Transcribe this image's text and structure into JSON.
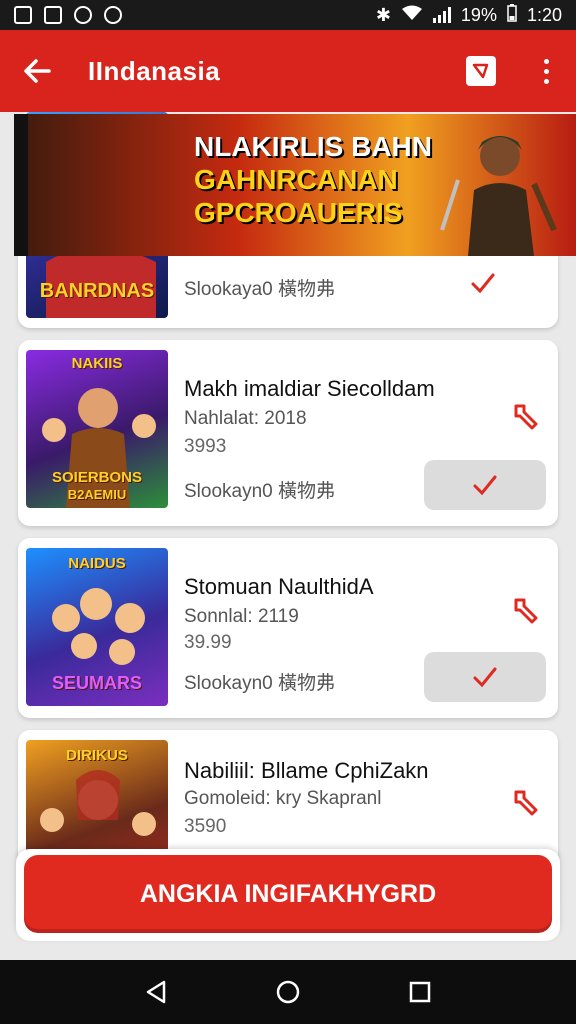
{
  "status_bar": {
    "battery": "19%",
    "time": "1:20"
  },
  "app_bar": {
    "title": "IIndanasia"
  },
  "banner": {
    "line1": "NLAKIRLIS BAHN",
    "line2": "GAHNRCANAN",
    "line3": "GPCROAUERIS"
  },
  "games": [
    {
      "thumb_title": "BANRDNAS",
      "status": "Slookayа0 橫物弗",
      "colors": [
        "#3aa0ff",
        "#2b2a8a"
      ]
    },
    {
      "thumb_title_top": "NAKIIS",
      "thumb_title": "SOIERBONS",
      "thumb_subtitle": "B2AEMIU",
      "title": "Makh imaldiar Siecolldam",
      "meta": "Nahlalat: 2018",
      "price": "3993",
      "status": "Slookayn0 橫物弗",
      "colors": [
        "#8a2be2",
        "#2d8f3a"
      ]
    },
    {
      "thumb_title_top": "NAIDUS",
      "thumb_title": "SEUMARS",
      "title": "Stomuan NaulthidA",
      "meta": "Sonnlal: 2119",
      "price": "39.99",
      "status": "Slookayn0 橫物弗",
      "colors": [
        "#1e90ff",
        "#7b2fbf"
      ]
    },
    {
      "thumb_title_top": "DIRIKUS",
      "title": "Nabiliil: Bllame CphiZakn",
      "meta": "Gomoleid: kry Skapranl",
      "price": "3590",
      "colors": [
        "#f0a020",
        "#b02a20"
      ]
    }
  ],
  "cta": {
    "label": "ANGKIA INGIFAKНYGRD"
  },
  "accent_color": "#d8241c"
}
